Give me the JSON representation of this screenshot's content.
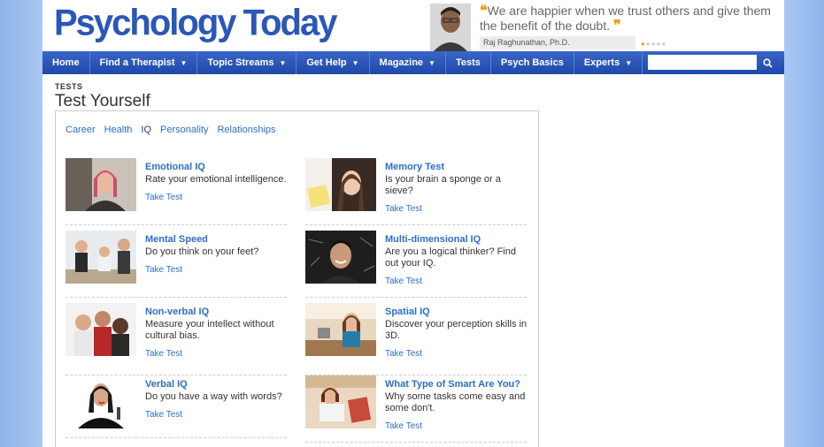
{
  "header": {
    "logo": "Psychology Today",
    "quote": "We are happier when we trust others and give them the benefit of the doubt.",
    "quote_author": "Raj Raghunathan, Ph.D."
  },
  "nav": {
    "items": [
      {
        "label": "Home",
        "dropdown": false
      },
      {
        "label": "Find a Therapist",
        "dropdown": true
      },
      {
        "label": "Topic Streams",
        "dropdown": true
      },
      {
        "label": "Get Help",
        "dropdown": true
      },
      {
        "label": "Magazine",
        "dropdown": true
      },
      {
        "label": "Tests",
        "dropdown": false
      },
      {
        "label": "Psych Basics",
        "dropdown": false
      },
      {
        "label": "Experts",
        "dropdown": true
      }
    ],
    "search_value": ""
  },
  "main": {
    "section_label": "TESTS",
    "title": "Test Yourself",
    "categories": [
      "Career",
      "Health",
      "IQ",
      "Personality",
      "Relationships"
    ],
    "active_category": "IQ",
    "take_label": "Take Test",
    "tests": [
      {
        "title": "Emotional IQ",
        "desc": "Rate your emotional intelligence."
      },
      {
        "title": "Memory Test",
        "desc": "Is your brain a sponge or a sieve?"
      },
      {
        "title": "Mental Speed",
        "desc": "Do you think on your feet?"
      },
      {
        "title": "Multi-dimensional IQ",
        "desc": "Are you a logical thinker? Find out your IQ."
      },
      {
        "title": "Non-verbal IQ",
        "desc": "Measure your intellect without cultural bias."
      },
      {
        "title": "Spatial IQ",
        "desc": "Discover your perception skills in 3D."
      },
      {
        "title": "Verbal IQ",
        "desc": "Do you have a way with words?"
      },
      {
        "title": "What Type of Smart Are You?",
        "desc": "Why some tasks come easy and some don't."
      }
    ]
  },
  "colors": {
    "nav_bg": "#2a55b8",
    "link": "#2a6fc7",
    "accent": "#e8a020"
  }
}
